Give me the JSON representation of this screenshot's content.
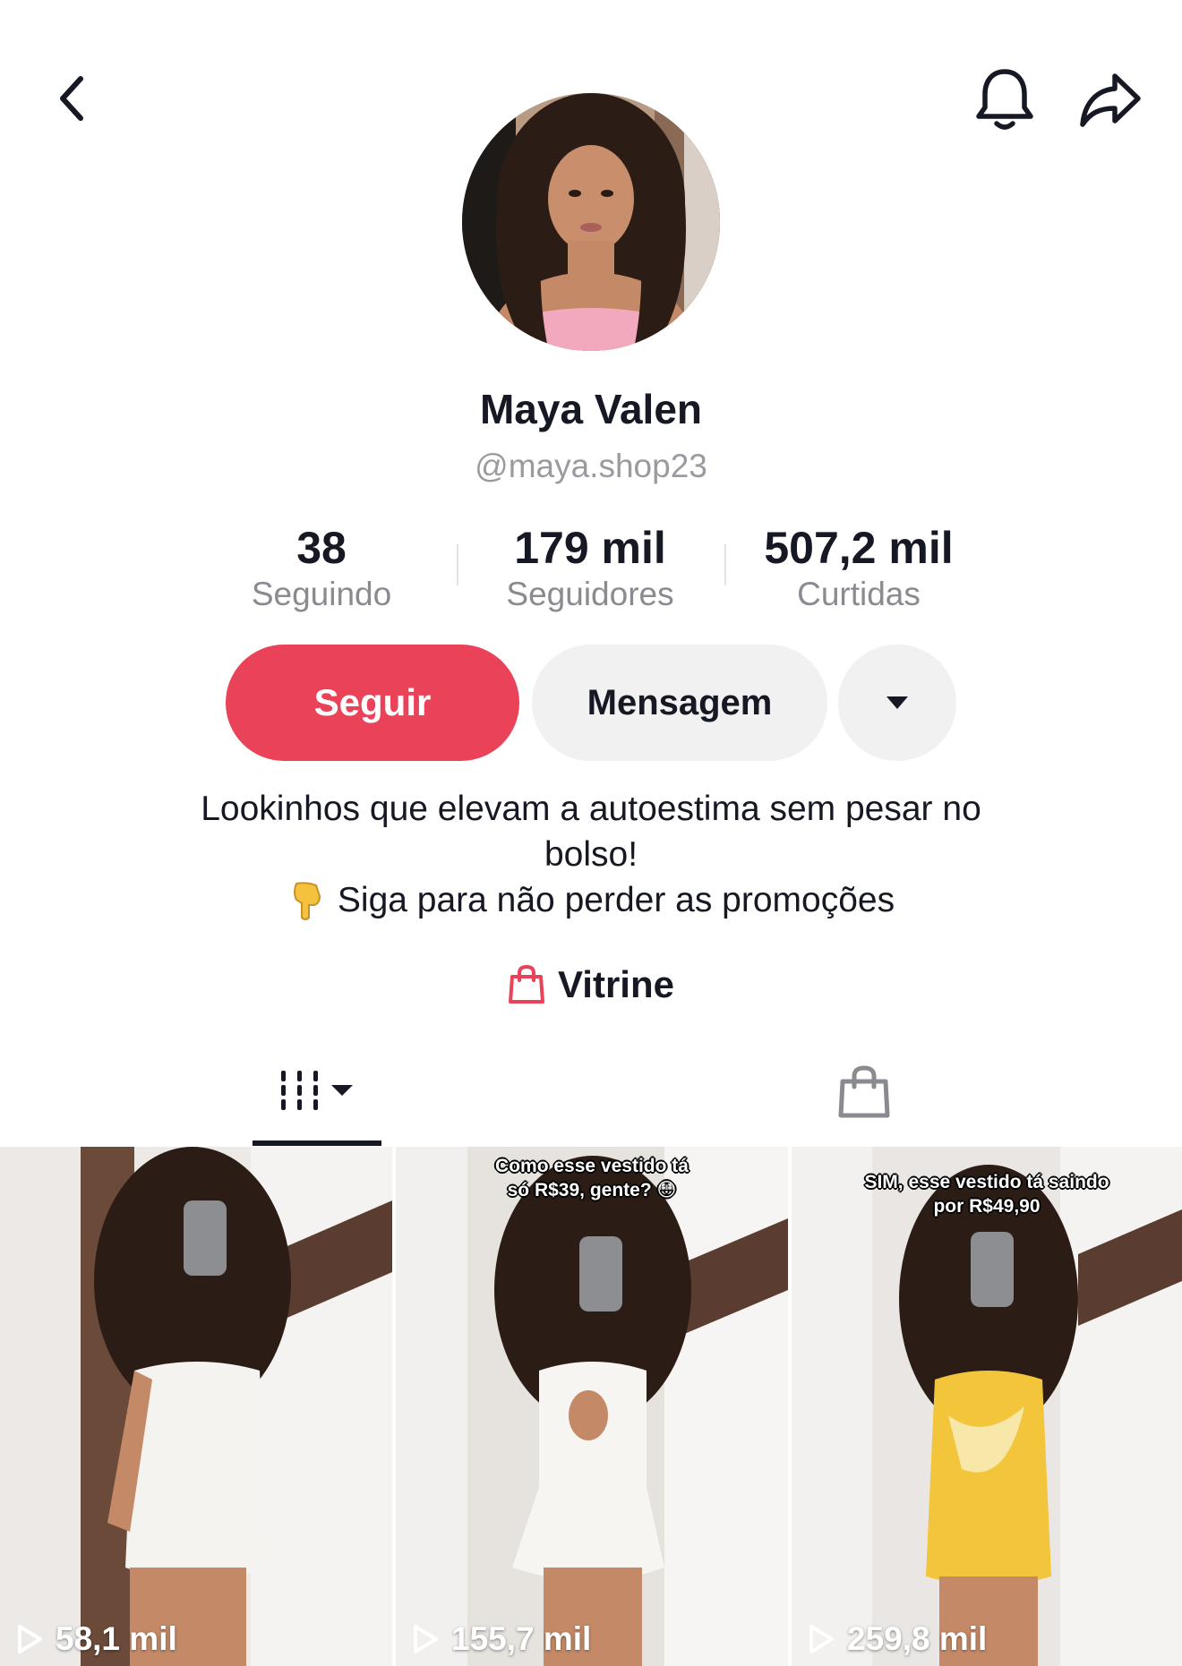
{
  "profile": {
    "display_name": "Maya Valen",
    "handle": "@maya.shop23"
  },
  "stats": [
    {
      "value": "38",
      "label": "Seguindo"
    },
    {
      "value": "179 mil",
      "label": "Seguidores"
    },
    {
      "value": "507,2 mil",
      "label": "Curtidas"
    }
  ],
  "actions": {
    "follow_label": "Seguir",
    "message_label": "Mensagem",
    "more_icon": "caret-down-icon"
  },
  "bio": {
    "line1": "Lookinhos que elevam a autoestima sem pesar no",
    "line2": "bolso!",
    "line3_emoji": "pointing-down-emoji",
    "line3": "Siga para não perder as promoções"
  },
  "storefront": {
    "icon": "shopping-bag-icon",
    "label": "Vitrine"
  },
  "tabs": [
    {
      "icon": "grid-icon",
      "active": true
    },
    {
      "icon": "shopping-bag-icon",
      "active": false
    }
  ],
  "videos": [
    {
      "caption": "",
      "views": "58,1 mil",
      "dress_color": "#f4f3f0"
    },
    {
      "caption_line1": "Como esse vestido tá",
      "caption_line2": "só R$39, gente? 😳",
      "views": "155,7 mil",
      "dress_color": "#f6f5f2"
    },
    {
      "caption_line1": "SIM, esse vestido tá saindo",
      "caption_line2": "por R$49,90",
      "views": "259,8 mil",
      "dress_color": "#f2c53a"
    }
  ],
  "colors": {
    "accent": "#ea4359",
    "secondary_button": "#f1f1f2",
    "text_primary": "#161823",
    "text_secondary": "#8a8b91"
  }
}
